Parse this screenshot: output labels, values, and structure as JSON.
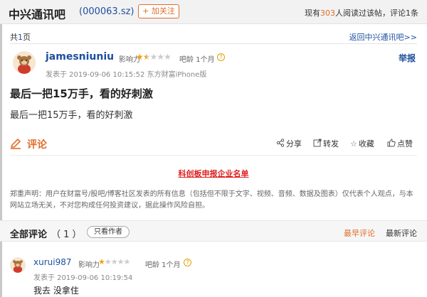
{
  "header": {
    "forum_title": "中兴通讯吧",
    "stock_code": "(000063.sz)",
    "follow_label": "+ 加关注",
    "reading_prefix": "现有",
    "reading_count": "303",
    "reading_suffix": "人阅读过该帖，评论",
    "comment_count": "1",
    "comment_unit": "条"
  },
  "nav": {
    "page_prefix": "共",
    "page_total": "1",
    "page_suffix": "页",
    "back_link": "返回中兴通讯吧>>"
  },
  "post": {
    "author": "jamesniuniu",
    "influence_label": "影响力",
    "influence_stars": 1.5,
    "bar_age": "吧龄 1个月",
    "report_label": "举报",
    "meta": "发表于 2019-09-06 10:15:52 东方财富iPhone版",
    "title": "最后一把15万手，看的好刺激",
    "body": "最后一把15万手，看的好刺激"
  },
  "toolbar": {
    "comment_label": "评论",
    "share": "分享",
    "repost": "转发",
    "favorite": "收藏",
    "like": "点赞"
  },
  "promo": {
    "link": "科创板申报企业名单"
  },
  "disclaimer": "郑重声明：用户在财富号/股吧/博客社区发表的所有信息（包括但不限于文字、视频、音频、数据及图表）仅代表个人观点，与本网站立场无关，不对您构成任何投资建议，据此操作风险自担。",
  "comments": {
    "title": "全部评论",
    "count": "（ 1 ）",
    "author_only": "只看作者",
    "sort_early": "最早评论",
    "sort_new": "最新评论",
    "items": [
      {
        "user": "xurui987",
        "influence_label": "影响力",
        "influence_stars": 1,
        "bar_age": "吧龄 1个月",
        "time": "发表于 2019-09-06 10:19:54",
        "text": "我去 没拿住"
      }
    ]
  },
  "colors": {
    "accent": "#e06e2b",
    "link": "#1d4f9e",
    "promo": "#e02020",
    "star": "#f2a20b"
  }
}
